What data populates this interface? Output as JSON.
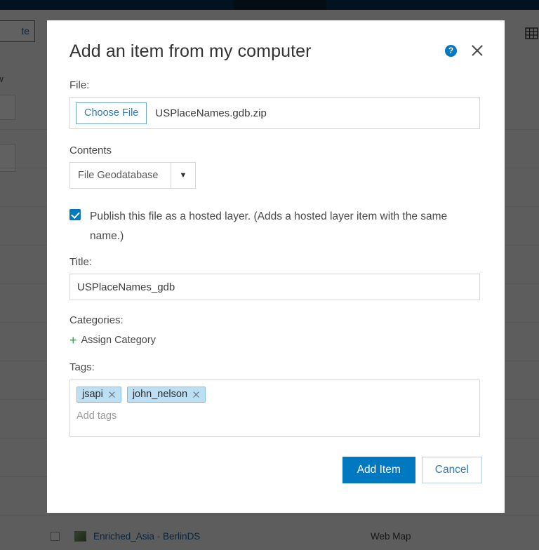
{
  "background": {
    "create_button_label": "te",
    "filter_label": "ew",
    "grid_icon": "grid-view-icon",
    "item_row": {
      "title": "Enriched_Asia - BerlinDS",
      "type": "Web Map"
    },
    "colors": {
      "topbar": "#0a3055",
      "topbar_tab": "#0d2233",
      "overlay": "rgba(0,0,0,0.62)",
      "link": "#1c5e9e"
    }
  },
  "modal": {
    "title": "Add an item from my computer",
    "help_icon": "help-circle-icon",
    "close_icon": "close-icon",
    "file": {
      "label": "File:",
      "choose_button_label": "Choose File",
      "file_name": "USPlaceNames.gdb.zip"
    },
    "contents": {
      "label": "Contents",
      "selected": "File Geodatabase",
      "arrow_icon": "chevron-down-icon",
      "options": [
        "File Geodatabase"
      ]
    },
    "publish": {
      "checked": true,
      "label": "Publish this file as a hosted layer. (Adds a hosted layer item with the same name.)"
    },
    "title_field": {
      "label": "Title:",
      "value": "USPlaceNames_gdb"
    },
    "categories": {
      "label": "Categories:",
      "assign_label": "Assign Category",
      "plus_icon": "plus-icon"
    },
    "tags": {
      "label": "Tags:",
      "chips": [
        {
          "text": "jsapi"
        },
        {
          "text": "john_nelson"
        }
      ],
      "placeholder": "Add tags"
    },
    "footer": {
      "submit_label": "Add Item",
      "cancel_label": "Cancel"
    },
    "colors": {
      "accent": "#0079c1",
      "chip_bg": "#bcdff3",
      "chip_border": "#84c0e0",
      "plus_green": "#3f9c54"
    }
  }
}
